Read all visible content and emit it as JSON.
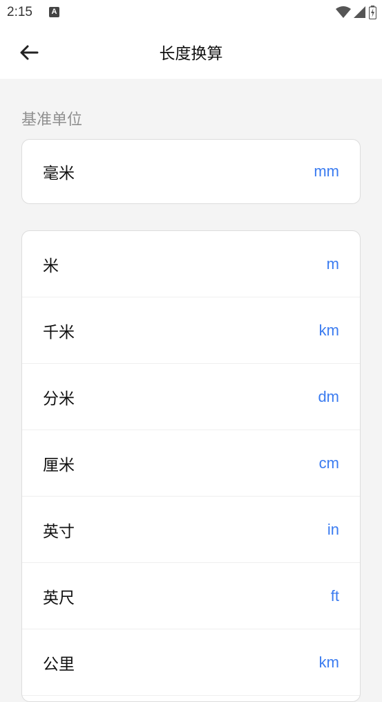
{
  "status_bar": {
    "time": "2:15",
    "notification_icon": "A"
  },
  "header": {
    "title": "长度换算",
    "back_icon": "arrow-left-icon"
  },
  "base_section": {
    "label": "基准单位",
    "unit": {
      "name": "毫米",
      "symbol": "mm"
    }
  },
  "units": [
    {
      "name": "米",
      "symbol": "m"
    },
    {
      "name": "千米",
      "symbol": "km"
    },
    {
      "name": "分米",
      "symbol": "dm"
    },
    {
      "name": "厘米",
      "symbol": "cm"
    },
    {
      "name": "英寸",
      "symbol": "in"
    },
    {
      "name": "英尺",
      "symbol": "ft"
    },
    {
      "name": "公里",
      "symbol": "km"
    }
  ],
  "colors": {
    "accent": "#3a7bf0",
    "background": "#f4f4f4",
    "card": "#ffffff"
  }
}
